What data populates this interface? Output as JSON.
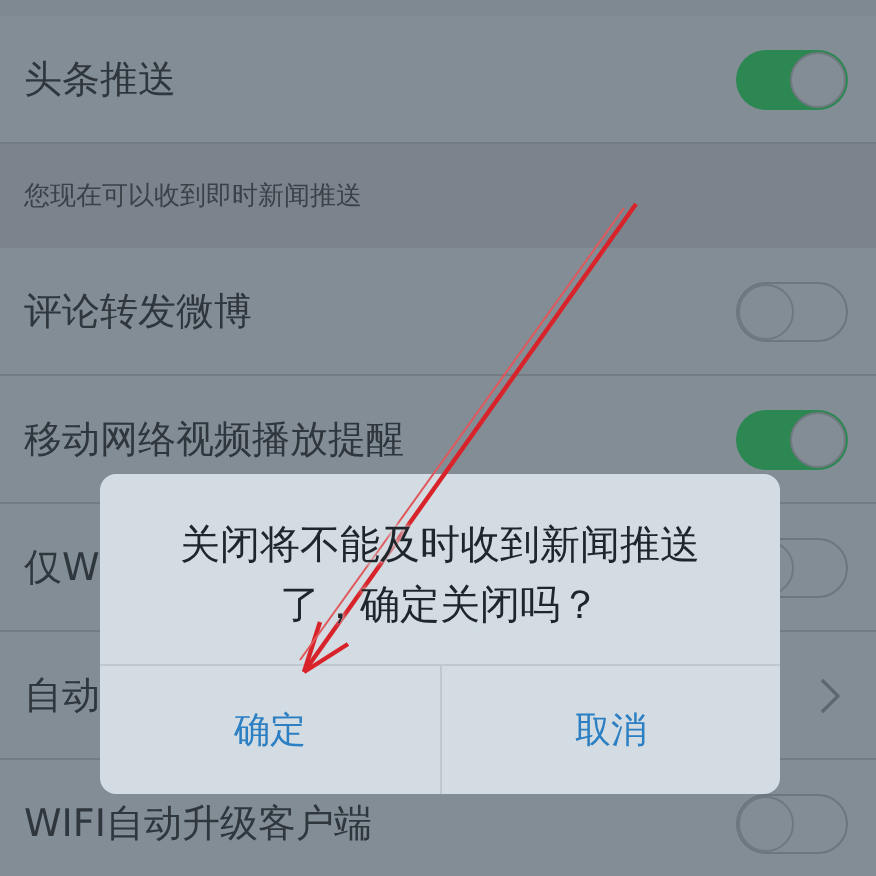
{
  "settings": [
    {
      "kind": "toggle",
      "label": "头条推送",
      "on": true
    },
    {
      "kind": "caption",
      "label": "您现在可以收到即时新闻推送"
    },
    {
      "kind": "toggle",
      "label": "评论转发微博",
      "on": false
    },
    {
      "kind": "toggle",
      "label": "移动网络视频播放提醒",
      "on": true
    },
    {
      "kind": "toggle",
      "label": "仅W",
      "on": false
    },
    {
      "kind": "link",
      "label": "自动"
    },
    {
      "kind": "toggle",
      "label": "WIFI自动升级客户端",
      "on": false
    }
  ],
  "dialog": {
    "message": "关闭将不能及时收到新闻推送了，确定关闭吗？",
    "buttons": [
      {
        "label": "确定"
      },
      {
        "label": "取消"
      }
    ]
  }
}
